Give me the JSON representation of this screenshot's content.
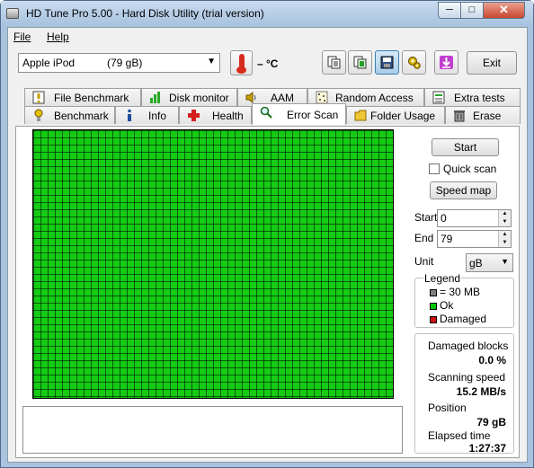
{
  "window": {
    "title": "HD Tune Pro 5.00 - Hard Disk Utility (trial version)",
    "buttons": {
      "minimize": "─",
      "maximize": "□",
      "close": "✕"
    }
  },
  "menu": {
    "file": "File",
    "help": "Help"
  },
  "toolbar": {
    "drive_name": "Apple   iPod",
    "drive_size": "(79 gB)",
    "temperature": "– °C",
    "exit_label": "Exit",
    "icons": [
      "copy-text-icon",
      "copy-screenshot-icon",
      "save-icon",
      "options-icon",
      "download-icon"
    ]
  },
  "tabs": {
    "row1": [
      {
        "label": "File Benchmark",
        "icon": "file-benchmark-icon"
      },
      {
        "label": "Disk monitor",
        "icon": "disk-monitor-icon"
      },
      {
        "label": "AAM",
        "icon": "speaker-icon"
      },
      {
        "label": "Random Access",
        "icon": "random-access-icon"
      },
      {
        "label": "Extra tests",
        "icon": "extra-tests-icon"
      }
    ],
    "row2": [
      {
        "label": "Benchmark",
        "icon": "benchmark-icon"
      },
      {
        "label": "Info",
        "icon": "info-icon"
      },
      {
        "label": "Health",
        "icon": "health-icon"
      },
      {
        "label": "Error Scan",
        "icon": "magnifier-icon"
      },
      {
        "label": "Folder Usage",
        "icon": "folder-icon"
      },
      {
        "label": "Erase",
        "icon": "trash-icon"
      }
    ],
    "active": "Error Scan"
  },
  "error_scan": {
    "start_button": "Start",
    "quick_scan_label": "Quick scan",
    "quick_scan_checked": false,
    "speed_map_button": "Speed map",
    "start_label": "Start",
    "start_value": "0",
    "end_label": "End",
    "end_value": "79",
    "unit_label": "Unit",
    "unit_value": "gB",
    "legend": {
      "title": "Legend",
      "items": [
        {
          "label": "= 30 MB",
          "color": "#808080"
        },
        {
          "label": "Ok",
          "color": "#00c800"
        },
        {
          "label": "Damaged",
          "color": "#d01010"
        }
      ]
    },
    "stats": {
      "damaged_blocks_label": "Damaged blocks",
      "damaged_blocks_value": "0.0 %",
      "scanning_speed_label": "Scanning speed",
      "scanning_speed_value": "15.2 MB/s",
      "position_label": "Position",
      "position_value": "79 gB",
      "elapsed_time_label": "Elapsed time",
      "elapsed_time_value": "1:27:37"
    },
    "grid_block_status": "Ok",
    "grid_color": "#00c800"
  }
}
